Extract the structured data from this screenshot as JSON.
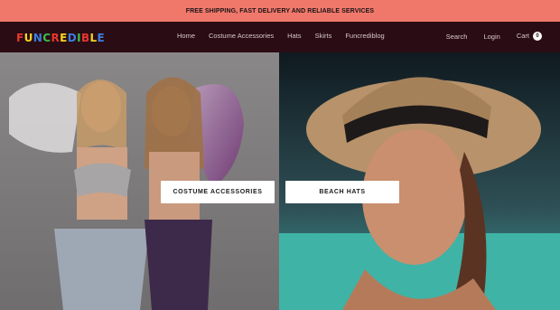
{
  "announcement": "FREE SHIPPING, FAST DELIVERY AND RELIABLE SERVICES",
  "brand": {
    "letters": [
      "F",
      "U",
      "N",
      "C",
      "R",
      "E",
      "D",
      "I",
      "B",
      "L",
      "E"
    ],
    "colors": [
      "#e8362e",
      "#f5d31e",
      "#3a7ee0",
      "#3bbf4a",
      "#e8362e",
      "#f5d31e",
      "#3a7ee0",
      "#3bbf4a",
      "#e8362e",
      "#f5d31e",
      "#3a7ee0"
    ]
  },
  "nav": {
    "items": [
      "Home",
      "Costume Accessories",
      "Hats",
      "Skirts",
      "Funcrediblog"
    ]
  },
  "utility": {
    "search": "Search",
    "login": "Login",
    "cart": "Cart",
    "cart_count": "0"
  },
  "hero": {
    "left_button": "COSTUME ACCESSORIES",
    "right_button": "BEACH HATS"
  },
  "colors": {
    "announcement_bg": "#f0786b",
    "header_bg": "#2a0c14"
  }
}
